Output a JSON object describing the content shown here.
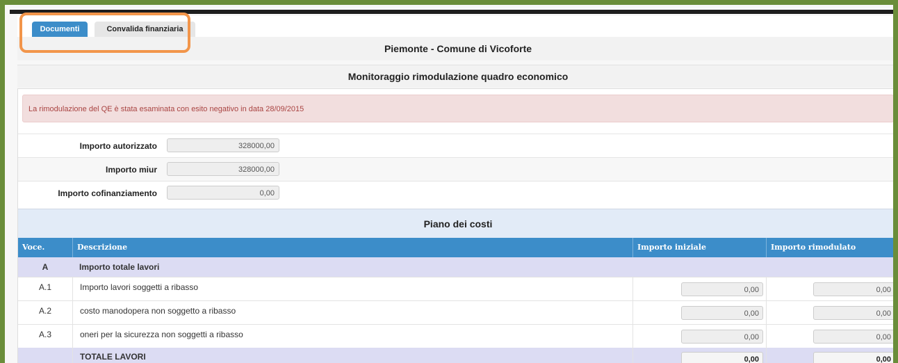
{
  "tabs": [
    {
      "label": "Documenti",
      "active": true
    },
    {
      "label": "Convalida finanziaria",
      "active": false
    }
  ],
  "header": {
    "region": "Piemonte - Comune di Vicoforte",
    "subtitle": "Monitoraggio rimodulazione quadro economico"
  },
  "alert": {
    "text": "La rimodulazione del QE è stata esaminata con esito negativo in data 28/09/2015"
  },
  "fields": [
    {
      "label": "Importo autorizzato",
      "value": "328000,00"
    },
    {
      "label": "Importo miur",
      "value": "328000,00"
    },
    {
      "label": "Importo cofinanziamento",
      "value": "0,00"
    }
  ],
  "table": {
    "title": "Piano dei costi",
    "columns": [
      "Voce.",
      "Descrizione",
      "Importo iniziale",
      "Importo rimodulato"
    ],
    "group": {
      "code": "A",
      "label": "Importo totale lavori"
    },
    "rows": [
      {
        "code": "A.1",
        "description": "Importo lavori soggetti a ribasso",
        "iniziale": "0,00",
        "rimodulato": "0,00"
      },
      {
        "code": "A.2",
        "description": "costo manodopera non soggetto a ribasso",
        "iniziale": "0,00",
        "rimodulato": "0,00"
      },
      {
        "code": "A.3",
        "description": "oneri per la sicurezza non soggetti a ribasso",
        "iniziale": "0,00",
        "rimodulato": "0,00"
      }
    ],
    "total": {
      "label": "TOTALE LAVORI",
      "iniziale": "0,00",
      "rimodulato": "0,00"
    }
  },
  "colors": {
    "tab_active": "#3c8dc9",
    "highlight": "#f2954a",
    "frame": "#6a8d3a",
    "alert_bg": "#f2dede",
    "alert_text": "#a94442",
    "group_row": "#dcdcf3"
  }
}
